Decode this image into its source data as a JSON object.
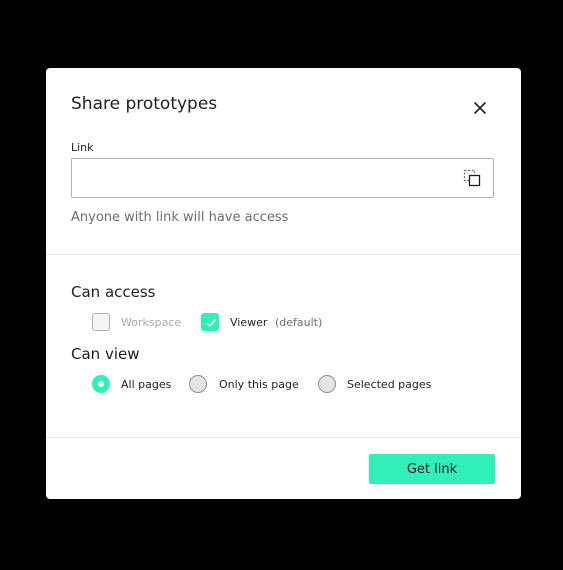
{
  "dialog": {
    "title": "Share prototypes",
    "close_icon": "close-icon"
  },
  "link": {
    "label": "Link",
    "value": "",
    "placeholder": "",
    "copy_icon": "copy-icon",
    "hint": "Anyone with link will have access"
  },
  "can_access": {
    "title": "Can access",
    "options": [
      {
        "label": "Workspace",
        "checked": false,
        "disabled": true
      },
      {
        "label": "Viewer",
        "suffix": "(default)",
        "checked": true,
        "disabled": false
      }
    ]
  },
  "can_view": {
    "title": "Can view",
    "options": [
      {
        "label": "All pages",
        "selected": true
      },
      {
        "label": "Only this page",
        "selected": false
      },
      {
        "label": "Selected pages",
        "selected": false
      }
    ]
  },
  "footer": {
    "primary_label": "Get link"
  },
  "colors": {
    "overlay": "#000000",
    "accent": "#31efb8",
    "text": "#1f1f1f",
    "muted_text": "#6b6d72",
    "disabled_text": "#aaabae",
    "border": "#b1b2b5"
  }
}
